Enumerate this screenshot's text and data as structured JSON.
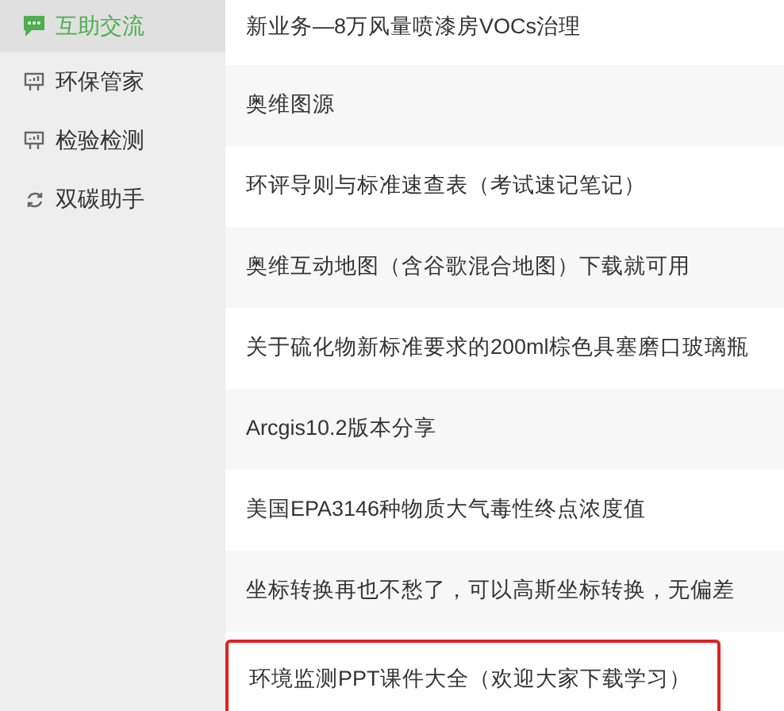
{
  "sidebar": {
    "items": [
      {
        "label": "互助交流",
        "selected": true
      },
      {
        "label": "环保管家",
        "selected": false
      },
      {
        "label": "检验检测",
        "selected": false
      },
      {
        "label": "双碳助手",
        "selected": false
      }
    ]
  },
  "posts": [
    {
      "title": "新业务—8万风量喷漆房VOCs治理",
      "highlighted": false
    },
    {
      "title": "奥维图源",
      "highlighted": false
    },
    {
      "title": "环评导则与标准速查表（考试速记笔记）",
      "highlighted": false
    },
    {
      "title": "奥维互动地图（含谷歌混合地图）下载就可用",
      "highlighted": false
    },
    {
      "title": "关于硫化物新标准要求的200ml棕色具塞磨口玻璃瓶",
      "highlighted": false
    },
    {
      "title": "Arcgis10.2版本分享",
      "highlighted": false
    },
    {
      "title": "美国EPA3146种物质大气毒性终点浓度值",
      "highlighted": false
    },
    {
      "title": "坐标转换再也不愁了，可以高斯坐标转换，无偏差",
      "highlighted": false
    },
    {
      "title": "环境监测PPT课件大全（欢迎大家下载学习）",
      "highlighted": true
    }
  ]
}
